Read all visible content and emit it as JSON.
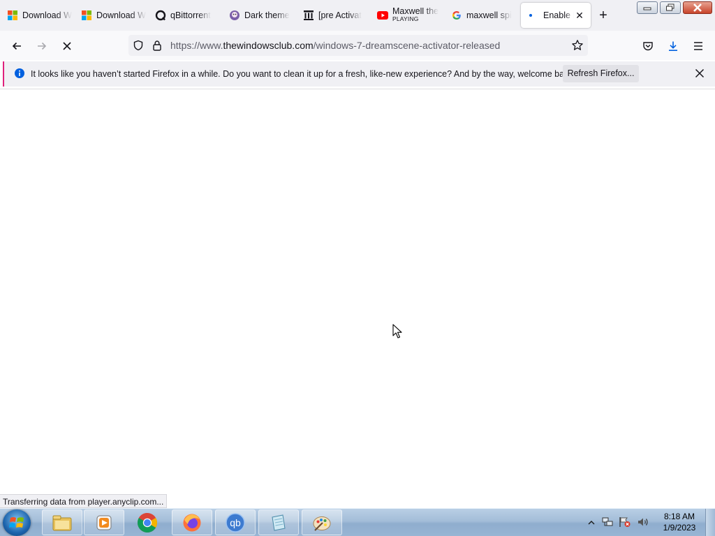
{
  "tabs": [
    {
      "title": "Download W",
      "icon": "windows-logo-icon"
    },
    {
      "title": "Download W",
      "icon": "windows-logo-icon"
    },
    {
      "title": "qBittorrent",
      "icon": "qbittorrent-icon"
    },
    {
      "title": "Dark theme",
      "icon": "theme-icon"
    },
    {
      "title": "[pre Activat",
      "icon": "archive-icon"
    },
    {
      "title": "Maxwell the",
      "subtitle": "PLAYING",
      "icon": "youtube-icon"
    },
    {
      "title": "maxwell spi",
      "icon": "google-icon"
    },
    {
      "title": "Enable Di",
      "icon": "loading-dot-icon",
      "active": true
    }
  ],
  "navbar": {
    "url_prefix": "https://www.",
    "url_domain": "thewindowsclub.com",
    "url_path": "/windows-7-dreamscene-activator-released"
  },
  "notification": {
    "message": "It looks like you haven’t started Firefox in a while. Do you want to clean it up for a fresh, like-new experience? And by the way, welcome back!",
    "button_label": "Refresh Firefox..."
  },
  "status_text": "Transferring data from player.anyclip.com...",
  "taskbar": {
    "apps": [
      "file-explorer-icon",
      "media-player-icon",
      "chrome-icon",
      "firefox-icon",
      "qbittorrent-icon",
      "notepad-icon",
      "paint-icon"
    ],
    "time": "8:18 AM",
    "date": "1/9/2023"
  },
  "colors": {
    "accent_pink": "#e0217c",
    "info_blue": "#0060df",
    "youtube_red": "#ff0000"
  }
}
